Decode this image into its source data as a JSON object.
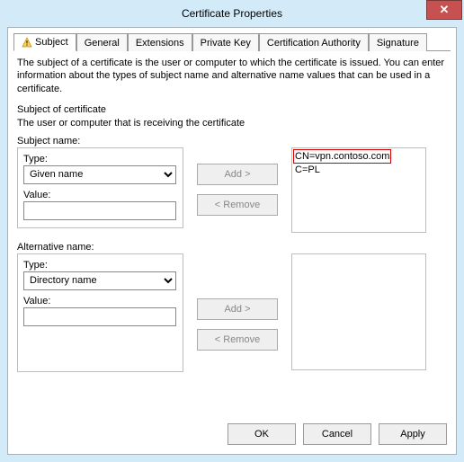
{
  "window": {
    "title": "Certificate Properties",
    "close_glyph": "✕"
  },
  "tabs": {
    "subject": "Subject",
    "general": "General",
    "extensions": "Extensions",
    "private_key": "Private Key",
    "cert_authority": "Certification Authority",
    "signature": "Signature"
  },
  "intro": "The subject of a certificate is the user or computer to which the certificate is issued. You can enter information about the types of subject name and alternative name values that can be used in a certificate.",
  "subject_of_cert": "Subject of certificate",
  "receiving_desc": "The user or computer that is receiving the certificate",
  "subject_name_label": "Subject name:",
  "alt_name_label": "Alternative name:",
  "type_label": "Type:",
  "value_label": "Value:",
  "subject_type_selected": "Given name",
  "subject_value": "",
  "alt_type_selected": "Directory name",
  "alt_value": "",
  "buttons": {
    "add": "Add >",
    "remove": "< Remove",
    "ok": "OK",
    "cancel": "Cancel",
    "apply": "Apply"
  },
  "subject_list": {
    "item0": "CN=vpn.contoso.com",
    "item1": "C=PL"
  }
}
